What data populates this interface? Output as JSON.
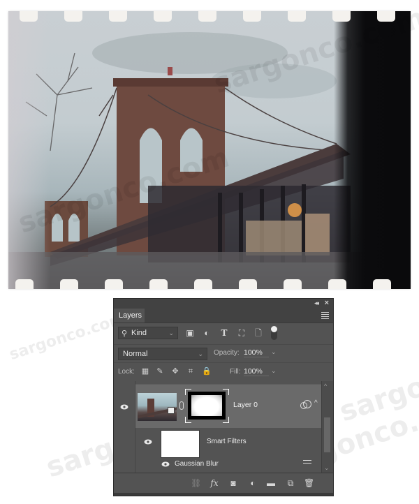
{
  "photo": {
    "description": "Vintage film-strip styled photo of the Brooklyn Bridge",
    "sprocket_count_top": 9,
    "sprocket_count_bottom": 9
  },
  "watermark": {
    "text": "sargonco.com"
  },
  "panel": {
    "title": "Layers",
    "collapse_icon": "double-chevron-left-icon",
    "close_icon": "close-icon",
    "menu_icon": "panel-menu-icon",
    "filter": {
      "kind_label": "Kind",
      "icons": [
        "pixel-filter-icon",
        "adjustment-filter-icon",
        "type-filter-icon",
        "shape-filter-icon",
        "smart-object-filter-icon"
      ],
      "toggle_on": true
    },
    "blend_mode": "Normal",
    "opacity_label": "Opacity:",
    "opacity_value": "100%",
    "lock_label": "Lock:",
    "lock_icons": [
      "lock-transparent-pixels-icon",
      "lock-image-pixels-icon",
      "lock-position-icon",
      "lock-artboard-icon",
      "lock-all-icon"
    ],
    "fill_label": "Fill:",
    "fill_value": "100%",
    "layers": [
      {
        "name": "Layer 0",
        "visible": true,
        "selected": true,
        "has_mask": true,
        "smart_object": true,
        "smart_filters": {
          "label": "Smart Filters",
          "visible": true,
          "filters": [
            {
              "name": "Gaussian Blur",
              "visible": true
            }
          ]
        }
      }
    ],
    "footer_icons": [
      "link-layers-icon",
      "fx-icon",
      "add-mask-icon",
      "adjustment-layer-icon",
      "new-group-icon",
      "new-layer-icon",
      "delete-icon"
    ],
    "footer_glyphs": {
      "link": "⛓",
      "fx": "fx",
      "mask": "◙",
      "adjust": "◐",
      "group": "▬",
      "new": "⧉",
      "trash": "🗑"
    }
  }
}
